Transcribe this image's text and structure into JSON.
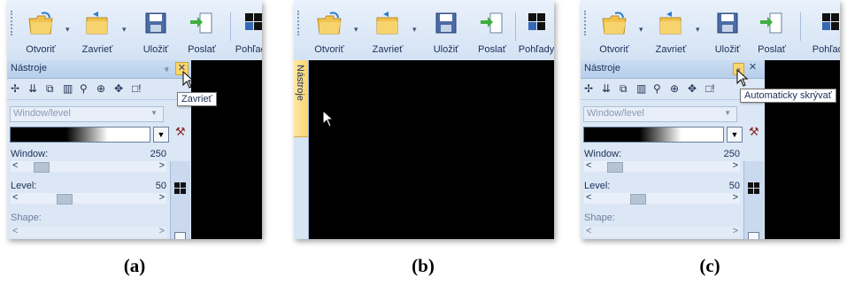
{
  "toolbar": {
    "open_label": "Otvoriť",
    "close_label": "Zavrieť",
    "save_label": "Uložiť",
    "send_label": "Poslať",
    "views_label": "Pohľady"
  },
  "tools_panel": {
    "title": "Nástroje",
    "pin_glyph": "ᵩ",
    "close_glyph": "✕",
    "mode_select": "Window/level",
    "window_label": "Window:",
    "window_value": "250",
    "level_label": "Level:",
    "level_value": "50",
    "shape_label": "Shape:",
    "slider_left": "<",
    "slider_right": ">",
    "toolbar_icons": [
      "cross-pointer-icon",
      "move-icon",
      "split-icon",
      "columns-icon",
      "zoom-icon",
      "zoom-area-icon",
      "pan-icon",
      "more-icon"
    ],
    "icon_glyphs": [
      "✢",
      "⇊",
      "⧉",
      "▥",
      "⚲",
      "⊕",
      "✥",
      "□!"
    ]
  },
  "tooltips": {
    "close": "Zavrieť",
    "autohide": "Automaticky skrývať"
  },
  "collapsed_tab": {
    "label": "Nástroje"
  },
  "captions": {
    "a": "(a)",
    "b": "(b)",
    "c": "(c)"
  },
  "colors": {
    "toolbar_bg": "#d3e2f4",
    "viewport_bg": "#000000",
    "hover_highlight": "#fbd66a"
  }
}
